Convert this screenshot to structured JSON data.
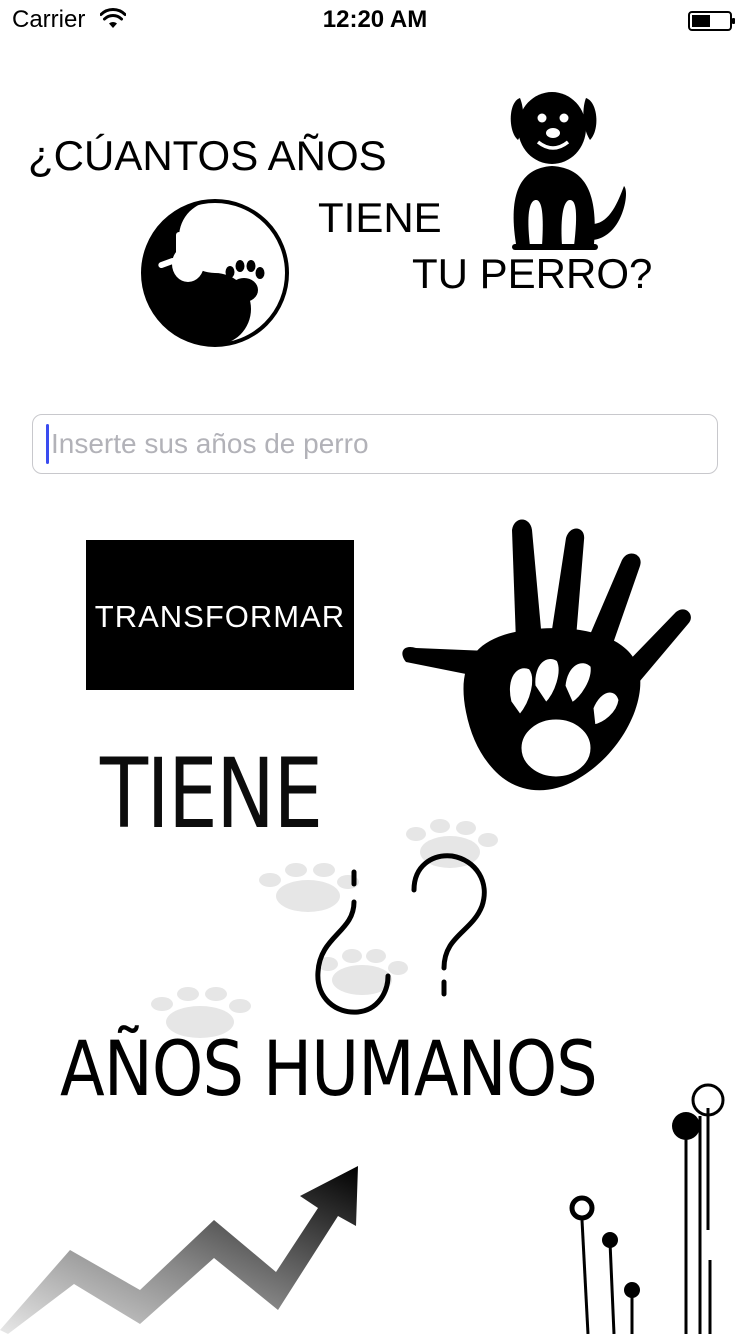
{
  "status_bar": {
    "carrier": "Carrier",
    "time": "12:20 AM",
    "icons": [
      "wifi-icon",
      "battery-icon"
    ]
  },
  "header": {
    "line1": "¿CÚANTOS AÑOS",
    "line2": "TIENE",
    "line3": "TU PERRO?",
    "icons": [
      "yin-yang-hand-paw-icon",
      "dog-icon"
    ]
  },
  "input": {
    "placeholder": "Inserte sus años de perro",
    "value": ""
  },
  "transform_button": {
    "label": "TRANSFORMAR"
  },
  "result": {
    "label_has": "TIENE",
    "value": "",
    "label_years": "AÑOS HUMANOS"
  },
  "decor": {
    "icons": [
      "hand-paw-icon",
      "question-mark-icon",
      "faint-paws-icon",
      "trend-arrow-icon",
      "circuit-icon"
    ],
    "accent": "#3a4cf0"
  }
}
